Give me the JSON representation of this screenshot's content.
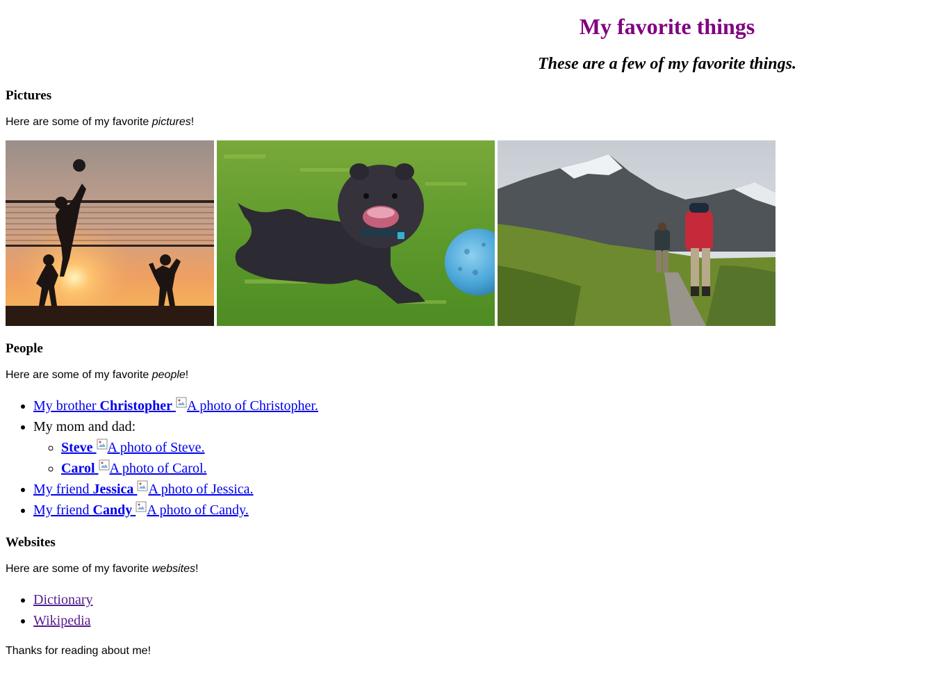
{
  "header": {
    "title": "My favorite things",
    "subtitle": "These are a few of my favorite things."
  },
  "pictures": {
    "heading": "Pictures",
    "intro_prefix": "Here are some of my favorite ",
    "intro_emphasis": "pictures",
    "intro_suffix": "!",
    "images": [
      "volleyball-silhouette-photo",
      "dog-with-ball-photo",
      "hikers-mountain-photo"
    ]
  },
  "people": {
    "heading": "People",
    "intro_prefix": "Here are some of my favorite ",
    "intro_emphasis": "people",
    "intro_suffix": "!",
    "christopher": {
      "prefix": "My brother ",
      "name": "Christopher",
      "alt": "A photo of Christopher."
    },
    "parents_label": "My mom and dad:",
    "steve": {
      "name": "Steve",
      "alt": "A photo of Steve."
    },
    "carol": {
      "name": "Carol",
      "alt": "A photo of Carol."
    },
    "jessica": {
      "prefix": "My friend ",
      "name": "Jessica",
      "alt": "A photo of Jessica."
    },
    "candy": {
      "prefix": "My friend ",
      "name": "Candy",
      "alt": "A photo of Candy."
    }
  },
  "websites": {
    "heading": "Websites",
    "intro_prefix": "Here are some of my favorite ",
    "intro_emphasis": "websites",
    "intro_suffix": "!",
    "links": [
      "Dictionary",
      "Wikipedia"
    ]
  },
  "footer": {
    "text": "Thanks for reading about me!"
  },
  "colors": {
    "title": "#800080",
    "link": "#0000ee",
    "visited_link": "#551a8b"
  }
}
